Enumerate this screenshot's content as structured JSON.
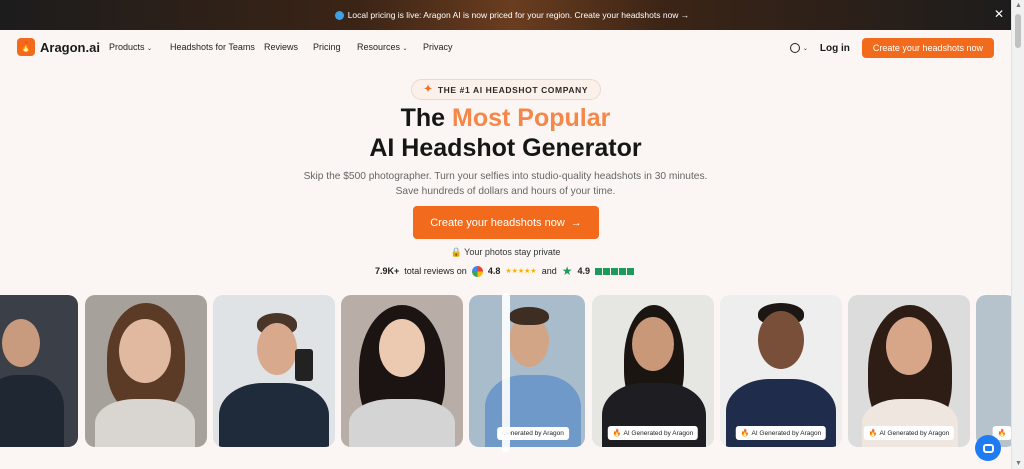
{
  "announcement": {
    "text": "Local pricing is live: Aragon AI is now priced for your region. Create your headshots now →"
  },
  "nav": {
    "brand": "Aragon.ai",
    "links": [
      "Products",
      "Headshots for Teams",
      "Reviews",
      "Pricing",
      "Resources",
      "Privacy"
    ],
    "login": "Log in",
    "cta": "Create your headshots now"
  },
  "hero": {
    "badge": "THE #1 AI HEADSHOT COMPANY",
    "title_pre": "The ",
    "title_accent": "Most Popular",
    "title_line2": "AI Headshot Generator",
    "subtitle": "Skip the $500 photographer. Turn your selfies into studio-quality headshots in 30 minutes. Save hundreds of dollars and hours of your time.",
    "cta": "Create your headshots now",
    "privacy": "Your photos stay private",
    "reviews_count": "7.9K+",
    "reviews_label": "total reviews on",
    "google_rating": "4.8",
    "and": "and",
    "trustpilot_rating": "4.9"
  },
  "photos": {
    "ai_label": "AI Generated by Aragon",
    "ai_label_partial": "Generated by Aragon"
  },
  "colors": {
    "brand": "#f26b1d",
    "accent_text": "#f5874a"
  }
}
